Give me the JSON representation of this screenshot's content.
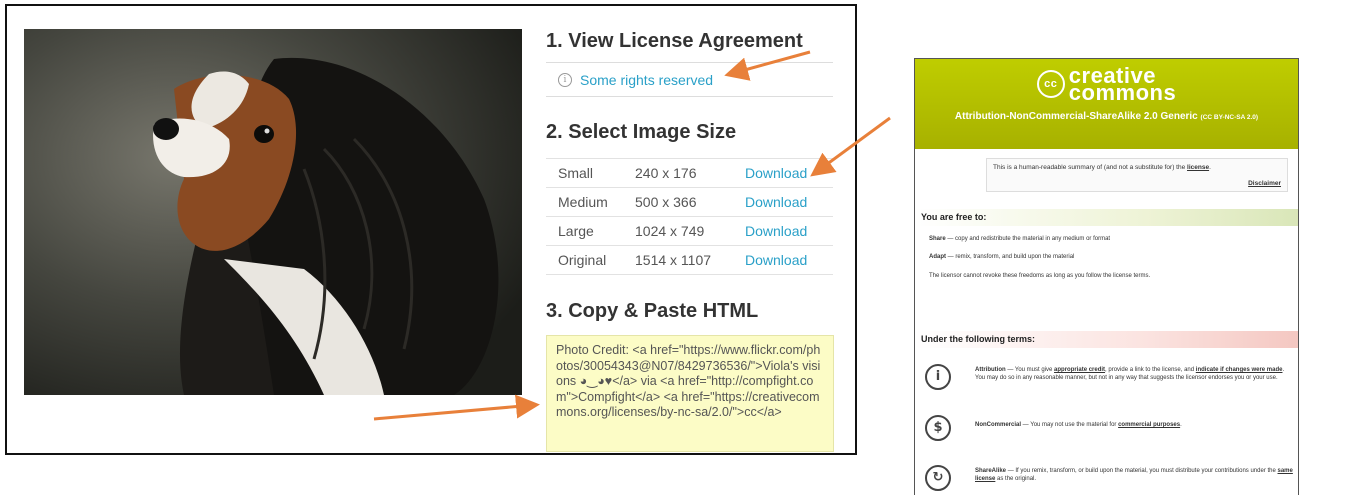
{
  "left": {
    "section1_title": "1. View License Agreement",
    "rights_link": "Some rights reserved",
    "section2_title": "2. Select Image Size",
    "sizes": [
      {
        "name": "Small",
        "dims": "240 x 176",
        "action": "Download"
      },
      {
        "name": "Medium",
        "dims": "500 x 366",
        "action": "Download"
      },
      {
        "name": "Large",
        "dims": "1024 x 749",
        "action": "Download"
      },
      {
        "name": "Original",
        "dims": "1514 x 1107",
        "action": "Download"
      }
    ],
    "section3_title": "3. Copy & Paste HTML",
    "html_code": "Photo Credit: <a href=\"https://www.flickr.com/photos/30054343@N07/8429736536/\">Viola's visions ◕‿◕♥</a> via <a href=\"http://compfight.com\">Compfight</a> <a href=\"https://creativecommons.org/licenses/by-nc-sa/2.0/\">cc</a>"
  },
  "right": {
    "logo_line1": "creative",
    "logo_line2": "commons",
    "logo_mark": "cc",
    "license_title": "Attribution-NonCommercial-ShareAlike 2.0 Generic",
    "license_code": "(CC BY-NC-SA 2.0)",
    "summary_text": "This is a human-readable summary of (and not a substitute for) the",
    "summary_link": "license",
    "disclaimer": "Disclaimer",
    "free_heading": "You are free to:",
    "share_label": "Share",
    "share_text": " — copy and redistribute the material in any medium or format",
    "adapt_label": "Adapt",
    "adapt_text": " — remix, transform, and build upon the material",
    "revoke_text": "The licensor cannot revoke these freedoms as long as you follow the license terms.",
    "terms_heading": "Under the following terms:",
    "attribution_label": "Attribution",
    "attribution_text1": " — You must give ",
    "attribution_link1": "appropriate credit",
    "attribution_text2": ", provide a link to the license, and ",
    "attribution_link2": "indicate if changes were made",
    "attribution_text3": ". You may do so in any reasonable manner, but not in any way that suggests the licensor endorses you or your use.",
    "noncommercial_label": "NonCommercial",
    "noncommercial_text": " — You may not use the material for ",
    "noncommercial_link": "commercial purposes",
    "noncommercial_end": ".",
    "sharealike_label": "ShareAlike",
    "sharealike_text": " — If you remix, transform, or build upon the material, you must distribute your contributions under the ",
    "sharealike_link": "same license",
    "sharealike_end": " as the original."
  },
  "colors": {
    "accent_link": "#2aa0c8",
    "arrow": "#e8803a",
    "cc_green": "#b3bf00",
    "code_bg": "#fcfcc6"
  },
  "icons": {
    "info": "info-icon",
    "attribution": "attribution-icon",
    "noncommercial": "noncommercial-icon",
    "sharealike": "sharealike-icon"
  }
}
